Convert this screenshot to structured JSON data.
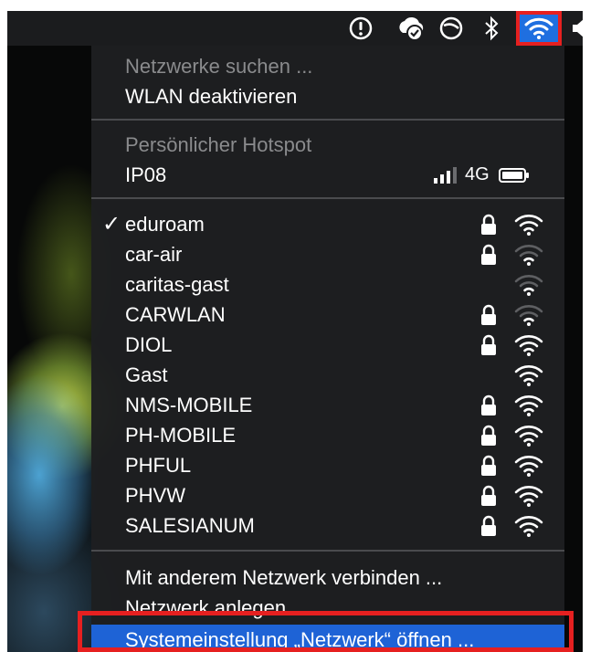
{
  "menu_header": {
    "scan_label": "Netzwerke suchen ...",
    "disable_wifi_label": "WLAN deaktivieren"
  },
  "hotspot": {
    "section_title": "Persönlicher Hotspot",
    "device_name": "IP08",
    "network_type": "4G"
  },
  "connected_network": {
    "checkmark": "✓",
    "name": "eduroam"
  },
  "networks": [
    {
      "name": "car-air"
    },
    {
      "name": "caritas-gast"
    },
    {
      "name": "CARWLAN"
    },
    {
      "name": "DIOL"
    },
    {
      "name": "Gast"
    },
    {
      "name": "NMS-MOBILE"
    },
    {
      "name": "PH-MOBILE"
    },
    {
      "name": "PHFUL"
    },
    {
      "name": "PHVW"
    },
    {
      "name": "SALESIANUM"
    }
  ],
  "actions": {
    "join_other": "Mit anderem Netzwerk verbinden ...",
    "create_network": "Netzwerk anlegen ...",
    "open_prefs": "Systemeinstellung „Netzwerk“ öffnen ..."
  },
  "colors": {
    "highlight": "#1e63d6",
    "annotation_red": "#e62020",
    "disabled_text": "#8a8b8d"
  }
}
